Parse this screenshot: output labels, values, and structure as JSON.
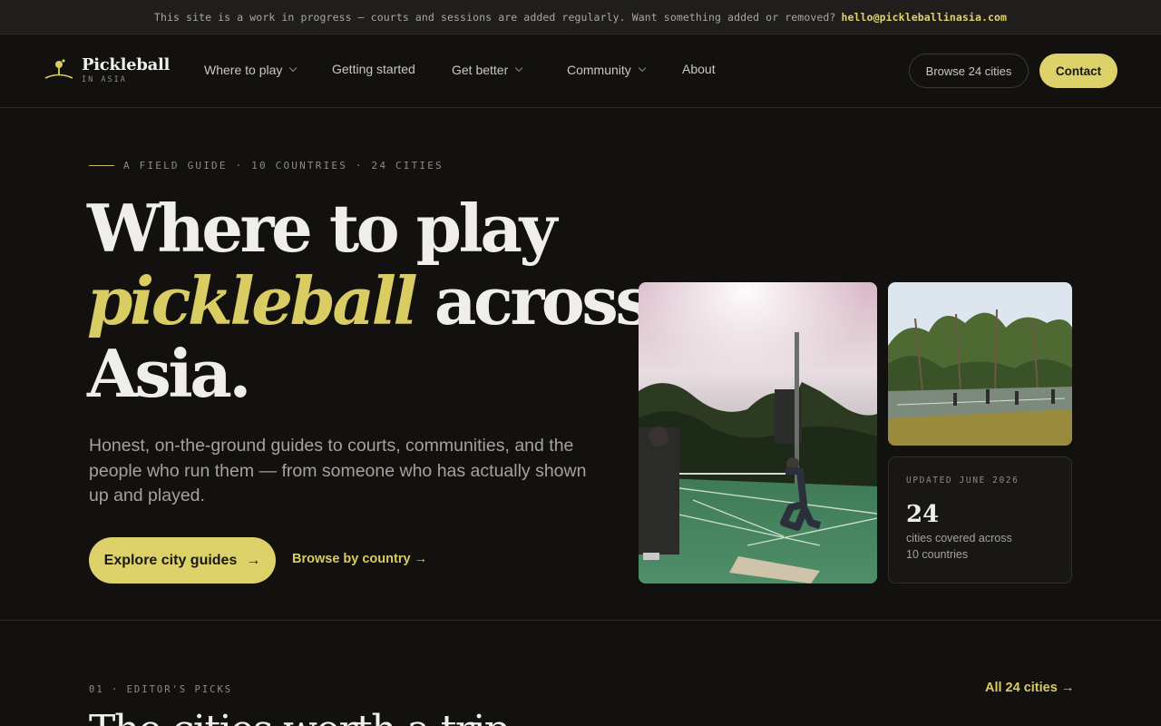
{
  "announcement": {
    "text": "This site is a work in progress — courts and sessions are added regularly. Want something added or removed?",
    "email": "hello@pickleballinasia.com"
  },
  "brand": {
    "name": "Pickleball",
    "tagline": "IN ASIA"
  },
  "nav": {
    "items": [
      {
        "label": "Where to play",
        "has_dropdown": true
      },
      {
        "label": "Getting started",
        "has_dropdown": false
      },
      {
        "label": "Get better",
        "has_dropdown": true
      },
      {
        "label": "Community",
        "has_dropdown": true
      },
      {
        "label": "About",
        "has_dropdown": false
      }
    ],
    "browse_label": "Browse 24 cities",
    "contact_label": "Contact"
  },
  "hero": {
    "eyebrow": "A FIELD GUIDE · 10 COUNTRIES · 24 CITIES",
    "headline_line1": "Where to play",
    "headline_em": "pickleball",
    "headline_rest": "across",
    "headline_line3": "Asia.",
    "lede": "Honest, on-the-ground guides to courts, communities, and the people who run them — from someone who has actually shown up and played.",
    "cta_primary": "Explore city guides",
    "cta_secondary": "Browse by country",
    "arrow": "→"
  },
  "stat_card": {
    "updated": "UPDATED JUNE 2026",
    "number": "24",
    "description": "cities covered across 10 countries"
  },
  "section": {
    "eyebrow": "01 · EDITOR'S PICKS",
    "all_link": "All 24 cities",
    "title": "The cities worth a trip"
  },
  "colors": {
    "accent": "#ddd26a",
    "background": "#121110",
    "court": "#4c8a62"
  }
}
